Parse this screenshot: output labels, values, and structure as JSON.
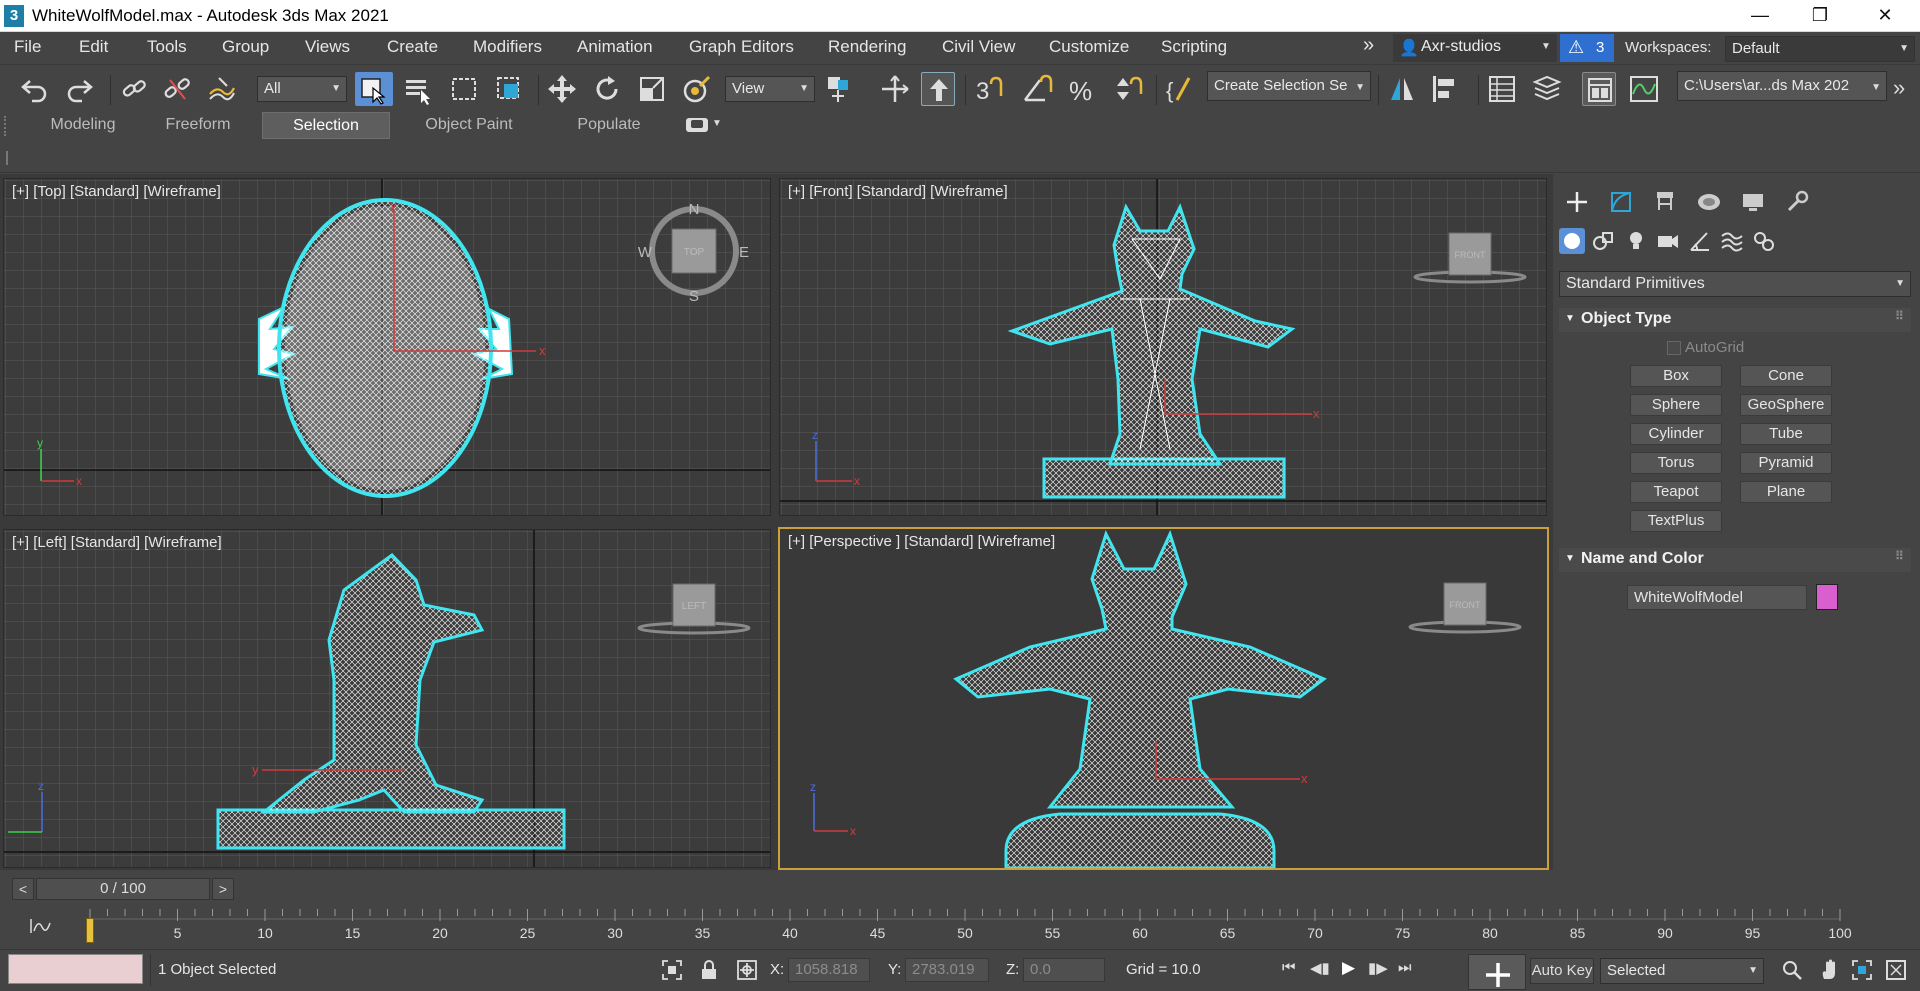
{
  "window": {
    "title": "WhiteWolfModel.max - Autodesk 3ds Max 2021",
    "app_icon_glyph": "3",
    "controls": [
      "minimize-icon",
      "restore-icon",
      "close-icon"
    ]
  },
  "menu": {
    "items": [
      "File",
      "Edit",
      "Tools",
      "Group",
      "Views",
      "Create",
      "Modifiers",
      "Animation",
      "Graph Editors",
      "Rendering",
      "Civil View",
      "Customize",
      "Scripting"
    ],
    "overflow": "»",
    "account": "Axr-studios",
    "notifications_count": "3",
    "workspaces_label": "Workspaces:",
    "workspace_value": "Default"
  },
  "toolbar": {
    "selection_filter": "All",
    "reference_coord": "View",
    "named_selection": "Create Selection Se",
    "project_path": "C:\\Users\\ar...ds Max 202",
    "snap_label": "3"
  },
  "ribbon": {
    "tabs": [
      "Modeling",
      "Freeform",
      "Selection",
      "Object Paint",
      "Populate"
    ],
    "active_tab": "Selection"
  },
  "viewports": {
    "top": {
      "label": "[+] [Top] [Standard] [Wireframe]",
      "viewcube": "TOP",
      "compass": [
        "N",
        "E",
        "S",
        "W"
      ]
    },
    "front": {
      "label": "[+] [Front] [Standard] [Wireframe]",
      "viewcube": "FRONT"
    },
    "left": {
      "label": "[+] [Left] [Standard] [Wireframe]",
      "viewcube": "LEFT"
    },
    "perspective": {
      "label": "[+] [Perspective ] [Standard] [Wireframe]",
      "viewcube": "FRONT"
    },
    "axis_labels": {
      "x": "x",
      "y": "y",
      "z": "z"
    }
  },
  "command_panel": {
    "category": "Standard Primitives",
    "object_type_header": "Object Type",
    "autogrid_label": "AutoGrid",
    "buttons": [
      "Box",
      "Cone",
      "Sphere",
      "GeoSphere",
      "Cylinder",
      "Tube",
      "Torus",
      "Pyramid",
      "Teapot",
      "Plane",
      "TextPlus"
    ],
    "name_color_header": "Name and Color",
    "object_name": "WhiteWolfModel",
    "object_color": "#d95fcf"
  },
  "timeline": {
    "frame_display": "0 / 100",
    "prev": "<",
    "next": ">",
    "ticks": [
      "0",
      "5",
      "10",
      "15",
      "20",
      "25",
      "30",
      "35",
      "40",
      "45",
      "50",
      "55",
      "60",
      "65",
      "70",
      "75",
      "80",
      "85",
      "90",
      "95",
      "100"
    ]
  },
  "status": {
    "selection": "1 Object Selected",
    "x_label": "X:",
    "x_value": "1058.818",
    "y_label": "Y:",
    "y_value": "2783.019",
    "z_label": "Z:",
    "z_value": "0.0",
    "grid": "Grid = 10.0",
    "auto_key": "Auto Key",
    "key_mode": "Selected"
  },
  "colors": {
    "accent_blue": "#5b8fd6",
    "active_viewport_border": "#c8a03c",
    "selection_outline": "#3fe6f0",
    "axis_x": "#d23a3a",
    "axis_y": "#3ad24a",
    "axis_z": "#4a6fe0"
  }
}
